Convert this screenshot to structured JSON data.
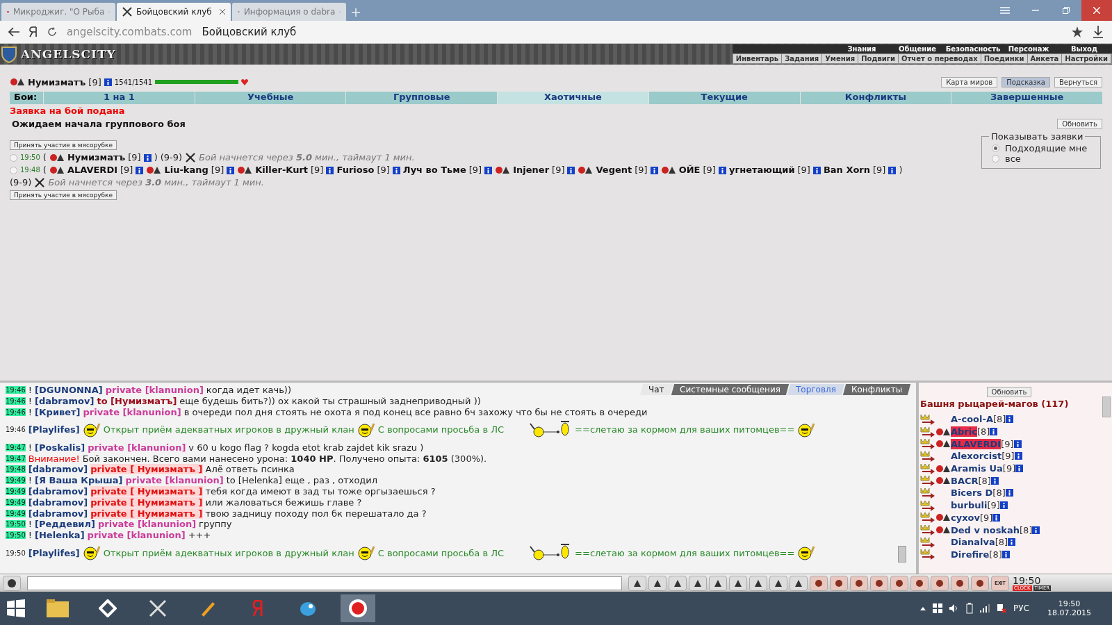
{
  "browser": {
    "tabs": [
      {
        "title": "Микроджиг. \"О Рыба",
        "kind": "video",
        "selected": false
      },
      {
        "title": "Бойцовский клуб",
        "kind": "swords",
        "selected": true
      },
      {
        "title": "Информация о dabra",
        "kind": "swords",
        "selected": false
      }
    ],
    "address": {
      "domain": "angelscity.combats.com",
      "title": "Бойцовский клуб"
    }
  },
  "site_header": {
    "logo": "ANGELSCITY",
    "top_menu": [
      "Знания",
      "Общение",
      "Безопасность",
      "Персонаж",
      "Выход"
    ],
    "sub_menu": [
      "Инвентарь",
      "Задания",
      "Умения",
      "Подвиги",
      "Отчет о переводах",
      "Поединки",
      "Анкета",
      "Настройки"
    ]
  },
  "player": {
    "name": "Нумизматъ",
    "rank": "[9]",
    "hp": "1541/1541",
    "level": 1.0
  },
  "top_buttons": [
    {
      "label": "Карта миров",
      "selected": false
    },
    {
      "label": "Подсказка",
      "selected": true
    },
    {
      "label": "Вернуться",
      "selected": false
    }
  ],
  "battle_tabs": {
    "label": "Бои:",
    "items": [
      {
        "label": "1 на 1",
        "selected": false
      },
      {
        "label": "Учебные",
        "selected": false
      },
      {
        "label": "Групповые",
        "selected": false
      },
      {
        "label": "Хаотичные",
        "selected": true
      },
      {
        "label": "Текущие",
        "selected": false
      },
      {
        "label": "Конфликты",
        "selected": false
      },
      {
        "label": "Завершенные",
        "selected": false
      }
    ]
  },
  "status": "Заявка на бой подана",
  "waiting": "Ожидаем начала группового боя",
  "refresh_button": "Обновить",
  "join_buttons": [
    "Принять участие в мясорубке",
    "Принять участие в мясорубке"
  ],
  "requests": [
    {
      "time": "19:50",
      "selected": false,
      "open": "(",
      "close": ")",
      "members": [
        {
          "name": "Нумизматъ",
          "rank": "[9]",
          "has_emblem": true
        }
      ],
      "range": "(9-9)",
      "note": "Бой начнется через **5.0** мин., таймаут 1 мин."
    },
    {
      "time": "19:48",
      "selected": false,
      "open": "(",
      "close": ")",
      "members": [
        {
          "name": "ALAVERDI",
          "rank": "[9]",
          "has_emblem": true
        },
        {
          "name": "Liu-kang",
          "rank": "[9]",
          "has_emblem": true
        },
        {
          "name": "Killer-Kurt",
          "rank": "[9]",
          "has_emblem": true
        },
        {
          "name": "Furioso",
          "rank": "[9]",
          "has_emblem": false
        },
        {
          "name": "Луч во Тьме",
          "rank": "[9]",
          "has_emblem": false
        },
        {
          "name": "Injener",
          "rank": "[9]",
          "has_emblem": true
        },
        {
          "name": "Vegent",
          "rank": "[9]",
          "has_emblem": true
        },
        {
          "name": "ОЙЕ",
          "rank": "[9]",
          "has_emblem": true
        },
        {
          "name": "угнетающий",
          "rank": "[9]",
          "has_emblem": false
        },
        {
          "name": "Ban Xorn",
          "rank": "[9]",
          "has_emblem": false
        }
      ],
      "range": "(9-9)",
      "note": "Бой начнется через **3.0** мин., таймаут 1 мин."
    }
  ],
  "filter": {
    "legend": "Показывать заявки",
    "options": [
      {
        "label": "Подходящие мне",
        "selected": true
      },
      {
        "label": "все",
        "selected": false
      }
    ]
  },
  "chat": {
    "tabs": [
      {
        "label": "Чат",
        "selected": true,
        "kind": "tab"
      },
      {
        "label": "Системные сообщения",
        "selected": false,
        "kind": "tab"
      },
      {
        "label": "Торговля",
        "selected": false,
        "kind": "link"
      },
      {
        "label": "Конфликты",
        "selected": false,
        "kind": "tab"
      }
    ],
    "messages": [
      {
        "time": "19:46",
        "time_marked": true,
        "mark": "!",
        "sender": "[DGUNONNA]",
        "kind": "clan",
        "target": "private [klanunion]",
        "text": "когда идет качь))"
      },
      {
        "time": "19:46",
        "time_marked": true,
        "mark": "!",
        "sender": "[dabramov]",
        "kind": "to",
        "target": "to [Нумизматъ]",
        "text": "еще будешь бить?)) ох какой ты страшный заднеприводный ))"
      },
      {
        "time": "19:46",
        "time_marked": true,
        "mark": "!",
        "sender": "[Кривет]",
        "kind": "clan",
        "target": "private [klanunion]",
        "text": "в очереди пол дня стоять не охота я под конец все равно бч захожу что бы не стоять в очереди"
      },
      {
        "time": "19:46",
        "time_marked": false,
        "sender": "[Playlifes]",
        "kind": "ad",
        "parts": [
          "Открыт приём адекватных игроков в дружный клан",
          "С вопросами просьба в ЛС",
          "==слетаю за кормом для ваших питомцев=="
        ]
      },
      {
        "time": "19:47",
        "time_marked": true,
        "mark": "!",
        "sender": "[Poskalis]",
        "kind": "clan",
        "target": "private [klanunion]",
        "text": "v 60 u kogo flag ? kogda etot krab zajdet kik srazu )"
      },
      {
        "time": "19:47",
        "time_marked": true,
        "kind": "system",
        "label": "Внимание!",
        "text": "Бой закончен. Всего вами нанесено урона: **1040 HP**. Получено опыта: **6105** (300%)."
      },
      {
        "time": "19:48",
        "time_marked": true,
        "sender": "[dabramov]",
        "kind": "personal",
        "target": "private [ Нумизматъ ]",
        "text": "Алё ответь псинка"
      },
      {
        "time": "19:49",
        "time_marked": true,
        "mark": "!",
        "sender": "[Я Ваша Крыша]",
        "kind": "clan",
        "target": "private [klanunion]",
        "text": "to [Helenka] еще , раз , отходил"
      },
      {
        "time": "19:49",
        "time_marked": true,
        "sender": "[dabramov]",
        "kind": "personal",
        "target": "private [ Нумизматъ ]",
        "text": "тебя когда имеют в зад ты тоже оргызаешься ?"
      },
      {
        "time": "19:49",
        "time_marked": true,
        "sender": "[dabramov]",
        "kind": "personal",
        "target": "private [ Нумизматъ ]",
        "text": "или жаловаться бежишь главе ?"
      },
      {
        "time": "19:49",
        "time_marked": true,
        "sender": "[dabramov]",
        "kind": "personal",
        "target": "private [ Нумизматъ ]",
        "text": "твою задницу походу пол бк перешатало да ?"
      },
      {
        "time": "19:50",
        "time_marked": true,
        "mark": "!",
        "sender": "[Реддевил]",
        "kind": "clan",
        "target": "private [klanunion]",
        "text": "группу"
      },
      {
        "time": "19:50",
        "time_marked": true,
        "mark": "!",
        "sender": "[Helenka]",
        "kind": "clan",
        "target": "private [klanunion]",
        "text": "+++"
      },
      {
        "time": "19:50",
        "time_marked": false,
        "sender": "[Playlifes]",
        "kind": "ad",
        "parts": [
          "Открыт приём адекватных игроков в дружный клан",
          "С вопросами просьба в ЛС",
          "==слетаю за кормом для ваших питомцев=="
        ]
      }
    ]
  },
  "room": {
    "refresh_button": "Обновить",
    "title": "Башня рыцарей-магов (117)",
    "users": [
      {
        "name": "A-cool-A",
        "rank": "[8]",
        "has_emblem": false,
        "highlighted": false
      },
      {
        "name": "Abric",
        "rank": "[8]",
        "has_emblem": true,
        "highlighted": true
      },
      {
        "name": "ALAVERDI",
        "rank": "[9]",
        "has_emblem": true,
        "highlighted": true
      },
      {
        "name": "Alexorcist",
        "rank": "[9]",
        "has_emblem": false,
        "highlighted": false
      },
      {
        "name": "Aramis Ua",
        "rank": "[9]",
        "has_emblem": true,
        "highlighted": false
      },
      {
        "name": "BACR",
        "rank": "[8]",
        "has_emblem": true,
        "highlighted": false
      },
      {
        "name": "Bicers D",
        "rank": "[8]",
        "has_emblem": false,
        "highlighted": false
      },
      {
        "name": "burbuli",
        "rank": "[9]",
        "has_emblem": false,
        "highlighted": false
      },
      {
        "name": "cyxov",
        "rank": "[9]",
        "has_emblem": true,
        "highlighted": false
      },
      {
        "name": "Ded v noskah",
        "rank": "[8]",
        "has_emblem": true,
        "highlighted": false
      },
      {
        "name": "Dianalva",
        "rank": "[8]",
        "has_emblem": false,
        "highlighted": false
      },
      {
        "name": "Direfire",
        "rank": "[8]",
        "has_emblem": false,
        "highlighted": false
      }
    ]
  },
  "chat_toolbar": {
    "clock": "19:50",
    "clock_label": "CLOCK",
    "timer_label": "TIMER",
    "exit_label": "EXIT"
  },
  "taskbar": {
    "language": "РУС",
    "time": "19:50",
    "date": "18.07.2015"
  }
}
